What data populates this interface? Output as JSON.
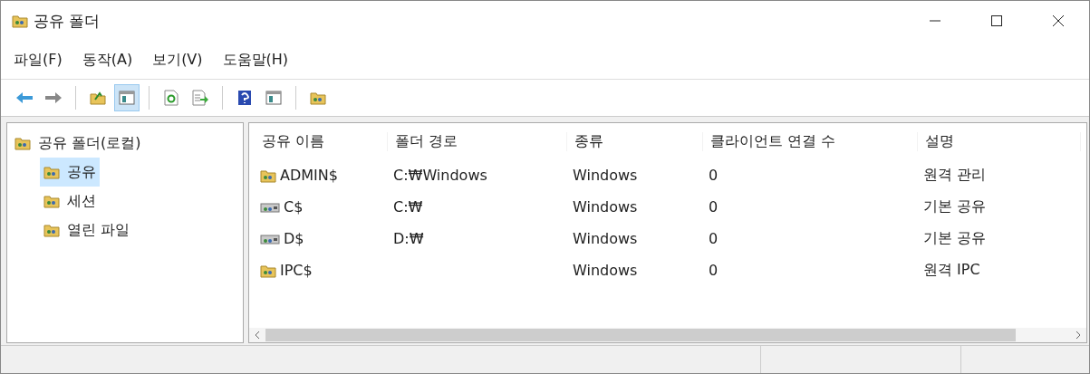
{
  "window": {
    "title": "공유 폴더"
  },
  "menu": [
    "파일(F)",
    "동작(A)",
    "보기(V)",
    "도움말(H)"
  ],
  "toolbar": [
    {
      "kind": "back",
      "pressed": false
    },
    {
      "kind": "forward",
      "pressed": false
    },
    {
      "kind": "sep"
    },
    {
      "kind": "up",
      "pressed": false
    },
    {
      "kind": "tree",
      "pressed": true
    },
    {
      "kind": "sep"
    },
    {
      "kind": "refresh",
      "pressed": false
    },
    {
      "kind": "export",
      "pressed": false
    },
    {
      "kind": "sep"
    },
    {
      "kind": "help",
      "pressed": false
    },
    {
      "kind": "pane",
      "pressed": false
    },
    {
      "kind": "sep"
    },
    {
      "kind": "share",
      "pressed": false
    }
  ],
  "tree": {
    "label": "공유 폴더(로컬)",
    "selected": false,
    "children": [
      {
        "label": "공유",
        "selected": true
      },
      {
        "label": "세션",
        "selected": false
      },
      {
        "label": "열린 파일",
        "selected": false
      }
    ]
  },
  "table": {
    "columns": [
      "공유 이름",
      "폴더 경로",
      "종류",
      "클라이언트 연결 수",
      "설명"
    ],
    "rows": [
      {
        "kind": "share",
        "cells": [
          "ADMIN$",
          "C:₩Windows",
          "Windows",
          "0",
          "원격 관리"
        ]
      },
      {
        "kind": "drive",
        "cells": [
          "C$",
          "C:₩",
          "Windows",
          "0",
          "기본 공유"
        ]
      },
      {
        "kind": "drive",
        "cells": [
          "D$",
          "D:₩",
          "Windows",
          "0",
          "기본 공유"
        ]
      },
      {
        "kind": "share",
        "cells": [
          "IPC$",
          "",
          "Windows",
          "0",
          "원격 IPC"
        ]
      }
    ]
  }
}
